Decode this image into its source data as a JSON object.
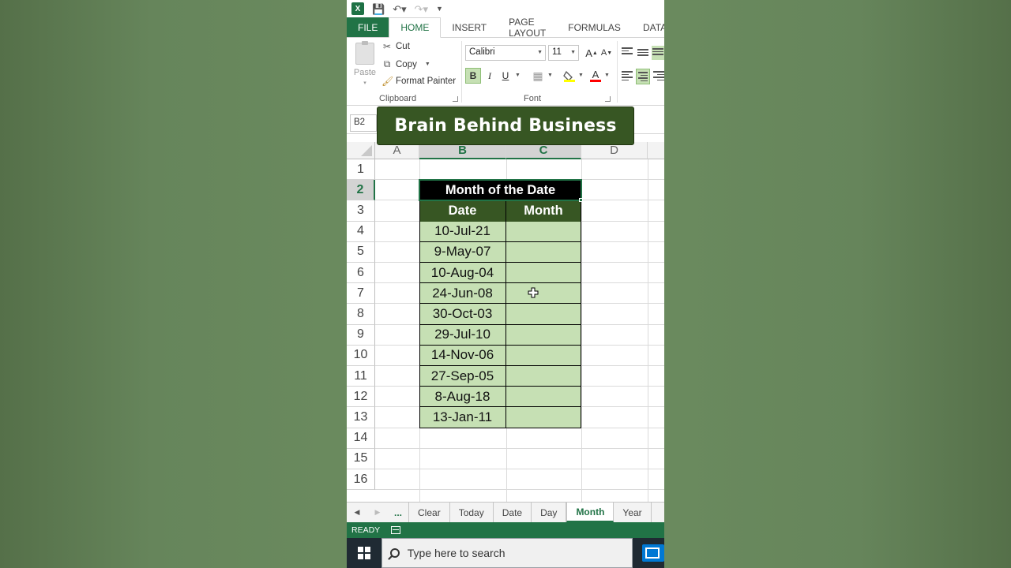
{
  "ribbon": {
    "tabs": [
      "FILE",
      "HOME",
      "INSERT",
      "PAGE LAYOUT",
      "FORMULAS",
      "DATA"
    ],
    "paste_label": "Paste",
    "cut_label": "Cut",
    "copy_label": "Copy",
    "format_painter_label": "Format Painter",
    "clipboard_group": "Clipboard",
    "font_group": "Font",
    "font_name": "Calibri",
    "font_size": "11",
    "bold": "B",
    "italic": "I",
    "underline": "U",
    "grow": "A",
    "shrink": "A",
    "font_color": "A"
  },
  "name_box": "B2",
  "banner": "Brain Behind Business",
  "sheet": {
    "columns": [
      "A",
      "B",
      "C",
      "D"
    ],
    "rows": [
      "1",
      "2",
      "3",
      "4",
      "5",
      "6",
      "7",
      "8",
      "9",
      "10",
      "11",
      "12",
      "13",
      "14",
      "15",
      "16"
    ],
    "title": "Month of the Date",
    "headers": [
      "Date",
      "Month"
    ],
    "dates": [
      "10-Jul-21",
      "9-May-07",
      "10-Aug-04",
      "24-Jun-08",
      "30-Oct-03",
      "29-Jul-10",
      "14-Nov-06",
      "27-Sep-05",
      "8-Aug-18",
      "13-Jan-11"
    ]
  },
  "sheet_tabs": [
    "...",
    "Clear",
    "Today",
    "Date",
    "Day",
    "Month",
    "Year"
  ],
  "active_sheet": "Month",
  "status": "READY",
  "taskbar": {
    "search_placeholder": "Type here to search"
  },
  "colors": {
    "excel_green": "#217346",
    "header_dark_green": "#375623",
    "data_light_green": "#c6e0b4"
  }
}
